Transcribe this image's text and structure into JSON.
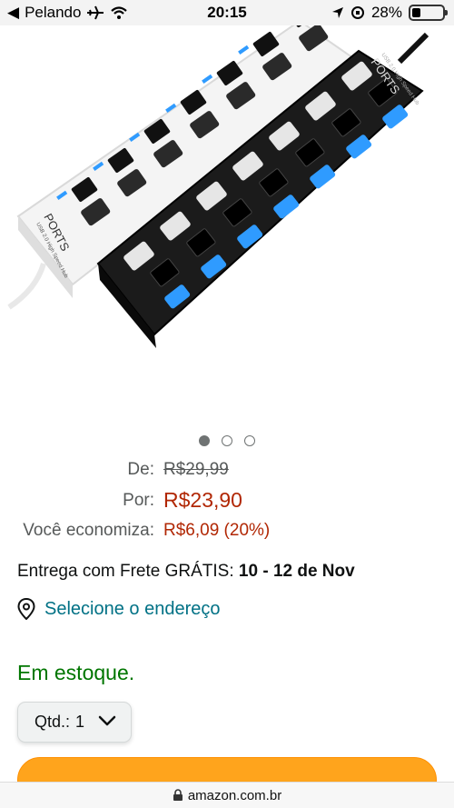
{
  "status_bar": {
    "carrier": "Pelando",
    "time": "20:15",
    "battery": "28%",
    "battery_level": 0.28
  },
  "product_image": {
    "white_hub_label": "PORTS",
    "white_hub_sublabel": "USB 2.0 High Speed Hub",
    "black_hub_label": "PORTS",
    "black_hub_sublabel": "USB 2.0 High Speed Hub"
  },
  "carousel": {
    "count": 3,
    "active_index": 0
  },
  "price": {
    "list_label": "De:",
    "list_price": "R$29,99",
    "sale_label": "Por:",
    "sale_price": "R$23,90",
    "savings_label": "Você economiza:",
    "savings_value": "R$6,09 (20%)"
  },
  "delivery": {
    "prefix": "Entrega com Frete GRÁTIS:",
    "dates": "10 - 12 de Nov"
  },
  "address": {
    "link": "Selecione o endereço"
  },
  "stock": {
    "text": "Em estoque."
  },
  "quantity": {
    "label": "Qtd.:",
    "value": "1"
  },
  "browser": {
    "url": "amazon.com.br"
  },
  "colors": {
    "price_red": "#b12704",
    "link_teal": "#007185",
    "stock_green": "#007600",
    "buy_button": "#ffa41c",
    "hub_led_blue": "#2f9bff"
  }
}
